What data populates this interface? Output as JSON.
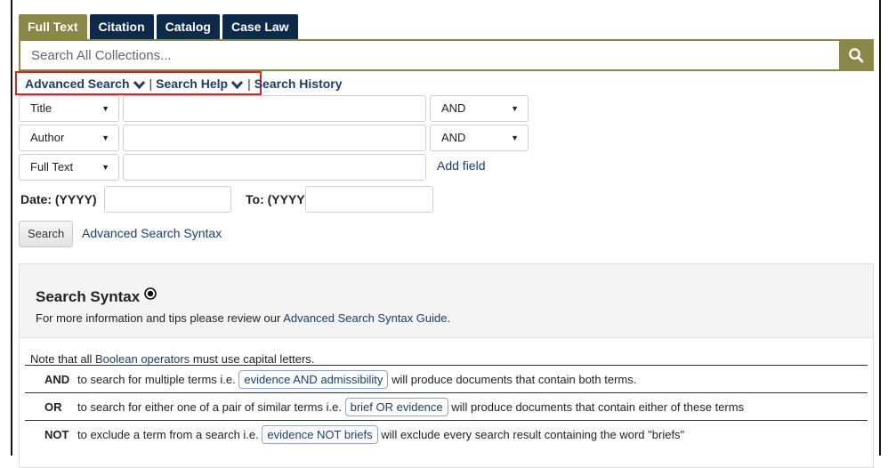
{
  "tabs": [
    {
      "label": "Full Text",
      "active": true
    },
    {
      "label": "Citation",
      "active": false
    },
    {
      "label": "Catalog",
      "active": false
    },
    {
      "label": "Case Law",
      "active": false
    }
  ],
  "search": {
    "placeholder": "Search All Collections...",
    "icon": "search-icon"
  },
  "links": {
    "advanced_search": "Advanced Search",
    "separator": "|",
    "search_help": "Search Help",
    "search_history": "Search History"
  },
  "fields": [
    {
      "select": "Title",
      "operator": "AND"
    },
    {
      "select": "Author",
      "operator": "AND"
    },
    {
      "select": "Full Text"
    }
  ],
  "add_field": "Add field",
  "date": {
    "from_label": "Date: (YYYY)",
    "to_label": "To: (YYYY)"
  },
  "buttons": {
    "search": "Search"
  },
  "advanced_syntax_link": "Advanced Search Syntax",
  "syntax_panel": {
    "title": "Search Syntax",
    "info_prefix": "For more information and tips please review our ",
    "info_link": "Advanced Search Syntax Guide",
    "info_suffix": ".",
    "note_prefix": "Note that all ",
    "note_link": "Boolean operators",
    "note_suffix": " must use capital letters.",
    "operators": [
      {
        "op": "AND",
        "before": "to search for multiple terms i.e.",
        "example": "evidence AND admissibility",
        "after": "will produce documents that contain both terms."
      },
      {
        "op": "OR",
        "before": "to search for either one of a pair of similar terms i.e.",
        "example": "brief OR evidence",
        "after": "will produce documents that contain either of these terms"
      },
      {
        "op": "NOT",
        "before": "to exclude a term from a search i.e.",
        "example": "evidence NOT briefs",
        "after": "will exclude every search result containing the word \"briefs\""
      }
    ]
  },
  "colors": {
    "tab_active": "#8b8746",
    "tab": "#0e2a4a",
    "link": "#1a3d6e",
    "highlight": "#e02020"
  }
}
